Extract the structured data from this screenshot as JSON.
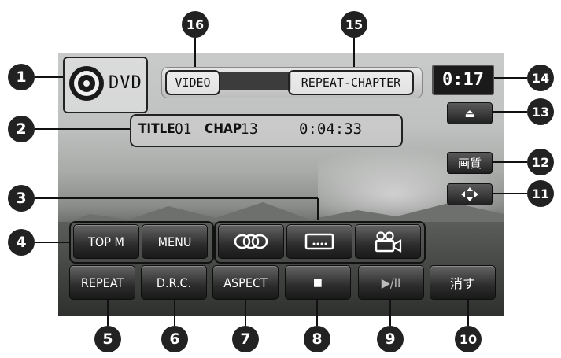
{
  "disc_label": "DVD",
  "status": {
    "source": "VIDEO",
    "repeat_mode": "REPEAT-CHAPTER"
  },
  "info": {
    "title_label": "TITLE",
    "title_num": "01",
    "chap_label": "CHAP",
    "chap_num": "13",
    "elapsed": "0:04:33"
  },
  "clock": "0:17",
  "right_buttons": {
    "eject": "⏏",
    "picture": "画質",
    "move": "move-arrows-icon"
  },
  "menu_buttons": {
    "top_menu": "TOP M",
    "menu": "MENU"
  },
  "function_icons": [
    "audio-icon",
    "subtitle-icon",
    "angle-icon"
  ],
  "bottom_buttons": {
    "repeat": "REPEAT",
    "drc": "D.R.C.",
    "aspect": "ASPECT",
    "stop": "■",
    "play_pause": "▶/II",
    "hide": "消す"
  },
  "callouts": [
    "1",
    "2",
    "3",
    "4",
    "5",
    "6",
    "7",
    "8",
    "9",
    "10",
    "11",
    "12",
    "13",
    "14",
    "15",
    "16"
  ]
}
